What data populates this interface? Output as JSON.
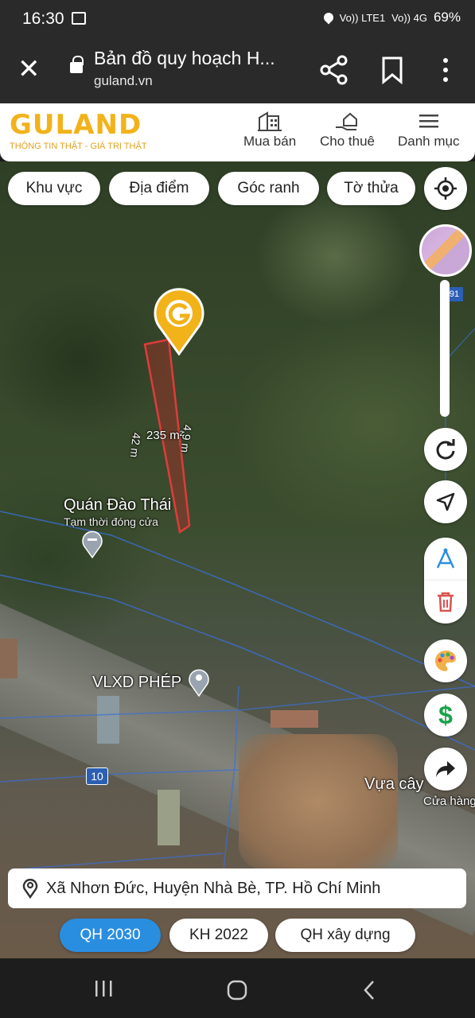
{
  "status": {
    "time": "16:30",
    "signal1": "Vo)) LTE1",
    "signal2": "Vo)) 4G",
    "battery": "69%"
  },
  "browser": {
    "title": "Bản đồ quy hoạch H...",
    "url": "guland.vn"
  },
  "site": {
    "logo_text": "GULAND",
    "tagline": "THÔNG TIN THẬT - GIÁ TRỊ THẬT",
    "nav": [
      {
        "label": "Mua bán",
        "icon": "building-icon"
      },
      {
        "label": "Cho thuê",
        "icon": "hand-house-icon"
      },
      {
        "label": "Danh mục",
        "icon": "menu-icon"
      }
    ]
  },
  "filters": [
    "Khu vực",
    "Địa điểm",
    "Góc ranh",
    "Tờ thửa"
  ],
  "map": {
    "parcel_area": "235 m²",
    "parcel_side1": "42 m",
    "parcel_side2": "4,9 m",
    "place1_name": "Quán Đào Thái",
    "place1_status": "Tạm thời đóng cửa",
    "place2_name": "VLXD PHÉP",
    "place3_name": "Vựa cây",
    "place3_sub": "Cửa hàng",
    "plot_number": "10",
    "plot_number2": "91"
  },
  "address": "Xã Nhơn Đức, Huyện Nhà Bè, TP. Hồ Chí Minh",
  "modes": [
    {
      "label": "QH 2030",
      "active": true
    },
    {
      "label": "KH 2022",
      "active": false
    },
    {
      "label": "QH xây dựng",
      "active": false
    }
  ],
  "colors": {
    "brand": "#f2b21a",
    "active_mode": "#2a8ee0",
    "parcel": "#e03b3b",
    "dollar": "#1aa34a",
    "trash": "#d9534f"
  }
}
